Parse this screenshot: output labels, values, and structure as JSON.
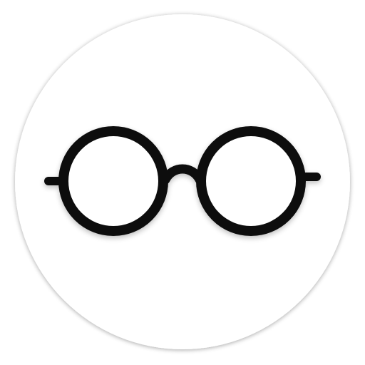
{
  "icon": {
    "name": "round-glasses-icon",
    "background_color": "#ffffff",
    "circle_color": "#ffffff",
    "frame_color": "#111111"
  }
}
